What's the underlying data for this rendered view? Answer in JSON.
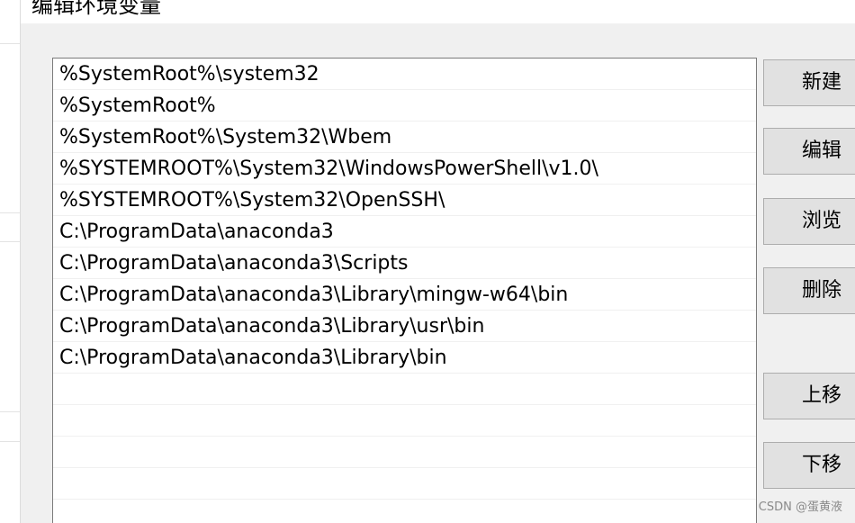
{
  "dialog": {
    "title": "编辑环境变量"
  },
  "path_list": {
    "items": [
      "%SystemRoot%\\system32",
      "%SystemRoot%",
      "%SystemRoot%\\System32\\Wbem",
      "%SYSTEMROOT%\\System32\\WindowsPowerShell\\v1.0\\",
      "%SYSTEMROOT%\\System32\\OpenSSH\\",
      "C:\\ProgramData\\anaconda3",
      "C:\\ProgramData\\anaconda3\\Scripts",
      "C:\\ProgramData\\anaconda3\\Library\\mingw-w64\\bin",
      "C:\\ProgramData\\anaconda3\\Library\\usr\\bin",
      "C:\\ProgramData\\anaconda3\\Library\\bin",
      "",
      "",
      "",
      "",
      ""
    ]
  },
  "buttons": {
    "new": "新建",
    "edit": "编辑",
    "browse": "浏览",
    "delete": "删除",
    "move_up": "上移",
    "move_down": "下移"
  },
  "watermark": "CSDN @蛋黄液"
}
